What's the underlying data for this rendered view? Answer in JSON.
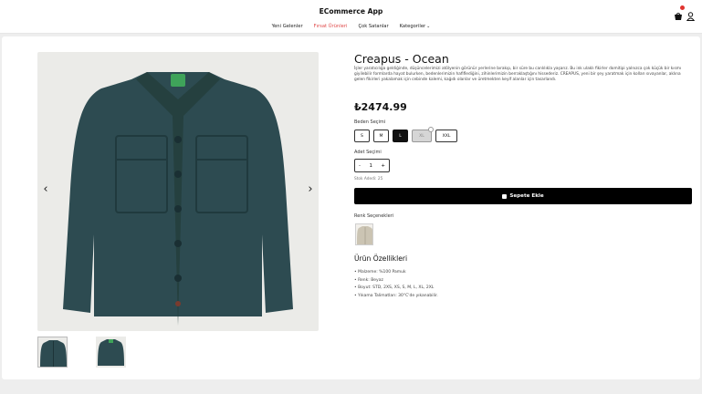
{
  "header": {
    "app_title": "ECommerce App",
    "nav": [
      {
        "label": "Yeni Gelenler"
      },
      {
        "label": "Fırsat Ürünleri"
      },
      {
        "label": "Çok Satanlar"
      },
      {
        "label": "Kategoriler"
      }
    ],
    "icons": [
      "cart-icon",
      "user-icon",
      "chevron-down-icon"
    ],
    "active_color": "#e04848"
  },
  "product": {
    "title": "Creapus - Ocean",
    "description": "İşler yaratıcılığa geldiğinde, düşüncelerimizi atölyenin görünür yerlerine bırakıp, bir süre bu canlılıkla yaşarız. Bu ink ulaklı fikirler domitipi yalnızca çok küçük bir kısmı giyilebilir formlarda hayat bulurken, bedenlerimizin hafiflediğini, zihinlerimizin berraklaştığını hissederiz. CREAPUS, yeni bir şey yaratmak için kolları sıvayanlar, aklına gelen fikirleri yakalamak için cebinde kalemi, kağıdı olanlar ve üretmekten keyif alanlar için tasarlandı.",
    "price": "₺2474.99",
    "size_label": "Beden Seçimi",
    "sizes": [
      {
        "label": "S",
        "state": "normal"
      },
      {
        "label": "M",
        "state": "normal"
      },
      {
        "label": "L",
        "state": "selected"
      },
      {
        "label": "XL",
        "state": "disabled"
      },
      {
        "label": "XXL",
        "state": "normal"
      }
    ],
    "quantity_label": "Adet Seçimi",
    "quantity": {
      "minus": "-",
      "value": "1",
      "plus": "+"
    },
    "stock": "Stok Adedi: 25",
    "add_to_cart": "Sepete Ekle",
    "color_label": "Renk Seçenekleri",
    "features_title": "Ürün Özellikleri",
    "features": [
      "Malzeme: %100 Pamuk",
      "Renk: Beyaz",
      "Boyut: STD, 2XS, XS, S, M, L, XL, 2XL",
      "Yıkama Talimatları: 30°C'de yıkanabilir."
    ]
  },
  "gallery": {
    "prev": "‹",
    "next": "›",
    "thumbnails": [
      "thumb-front",
      "thumb-back"
    ],
    "jacket_color": "#2c4a4f"
  }
}
